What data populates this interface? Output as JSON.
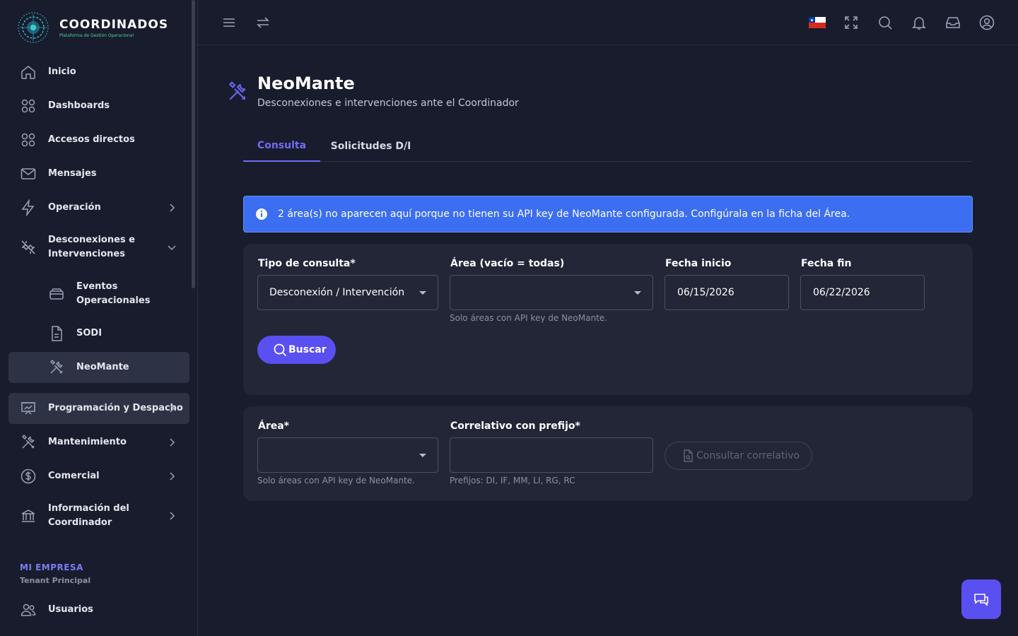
{
  "brand": {
    "title": "COORDINADOS",
    "subtitle": "Plataforma de Gestión Operacional"
  },
  "sidebar": {
    "items": [
      {
        "label": "Inicio",
        "icon": "home-icon"
      },
      {
        "label": "Dashboards",
        "icon": "grid-icon"
      },
      {
        "label": "Accesos directos",
        "icon": "grid-icon"
      },
      {
        "label": "Mensajes",
        "icon": "mail-icon"
      },
      {
        "label": "Operación",
        "icon": "bolt-icon",
        "chevron": "right"
      },
      {
        "label": "Desconexiones e Intervenciones",
        "icon": "plug-off-icon",
        "chevron": "down"
      },
      {
        "label": "Eventos Operacionales",
        "icon": "archive-icon"
      },
      {
        "label": "SODI",
        "icon": "file-icon"
      },
      {
        "label": "NeoMante",
        "icon": "tools-icon",
        "active": true
      },
      {
        "label": "Programación y Despacho",
        "icon": "presentation-chart-icon",
        "chevron": "right"
      },
      {
        "label": "Mantenimiento",
        "icon": "tools-icon",
        "chevron": "right"
      },
      {
        "label": "Comercial",
        "icon": "dollar-icon",
        "chevron": "right"
      },
      {
        "label": "Información del Coordinador",
        "icon": "bank-icon",
        "chevron": "right"
      }
    ],
    "company_section": {
      "title": "MI EMPRESA",
      "subtitle": "Tenant Principal"
    },
    "users_label": "Usuarios"
  },
  "header": {
    "title": "NeoMante",
    "subtitle": "Desconexiones e intervenciones ante el Coordinador"
  },
  "tabs": [
    {
      "label": "Consulta",
      "active": true
    },
    {
      "label": "Solicitudes D/I",
      "active": false
    }
  ],
  "alert": {
    "text": "2 área(s) no aparecen aquí porque no tienen su API key de NeoMante configurada. Configúrala en la ficha del Área."
  },
  "query_form": {
    "tipo_label": "Tipo de consulta*",
    "tipo_value": "Desconexión / Intervención",
    "area_label": "Área (vacío = todas)",
    "area_value": "",
    "area_hint": "Solo áreas con API key de NeoMante.",
    "fecha_inicio_label": "Fecha inicio",
    "fecha_inicio_value": "06/15/2026",
    "fecha_fin_label": "Fecha fin",
    "fecha_fin_value": "06/22/2026",
    "search_button": "Buscar"
  },
  "correlative_form": {
    "area_label": "Área*",
    "area_value": "",
    "area_hint": "Solo áreas con API key de NeoMante.",
    "correlativo_label": "Correlativo con prefijo*",
    "correlativo_value": "",
    "correlativo_hint": "Prefijos: DI, IF, MM, LI, RG, RC",
    "consult_button": "Consultar correlativo"
  },
  "colors": {
    "accent": "#5a4ff0",
    "alert_bg": "#3b6ef0",
    "background": "#191c2c",
    "card": "#222637"
  }
}
